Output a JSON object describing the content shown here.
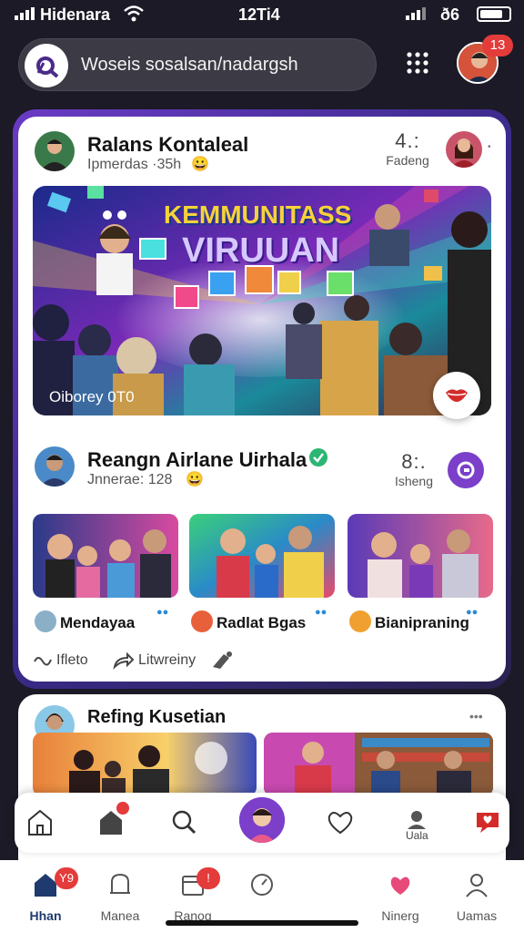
{
  "status_bar": {
    "carrier": "Hidenara",
    "time": "12Ti4",
    "battery": "ð6"
  },
  "search": {
    "text": "Woseis sosalsan/nadargsh"
  },
  "top_badge": "13",
  "post1": {
    "name": "Ralans Kontaleal",
    "meta": "Ipmerdas ·35h",
    "stat_num": "4.:",
    "stat_label": "Fadeng",
    "hero_title_line1": "KEMMUNITASS",
    "hero_title_line2": "VIRUUAN",
    "hero_caption": "Oiborey 0T0"
  },
  "post2": {
    "name": "Reangn Airlane Uirhala",
    "meta": "Jnnerae: 128",
    "stat_num": "8:.",
    "stat_label": "Isheng",
    "thumbs": [
      {
        "label": "Mendayaa"
      },
      {
        "label": "Radlat Bgas"
      },
      {
        "label": "Bianipraning"
      }
    ],
    "actions": {
      "like": "Ifleto",
      "share": "Litwreiny"
    }
  },
  "post3": {
    "name": "Refing Kusetian",
    "more": "•••"
  },
  "inner_nav": {
    "label": "Uala"
  },
  "tabbar": {
    "tabs": [
      {
        "label": "Hhan",
        "badge": "Y9"
      },
      {
        "label": "Manea",
        "badge": ""
      },
      {
        "label": "Ranog",
        "badge": "!"
      },
      {
        "label": "",
        "badge": ""
      },
      {
        "label": "Ninerg",
        "badge": ""
      },
      {
        "label": "Uamas",
        "badge": ""
      }
    ]
  },
  "colors": {
    "accent": "#7b3fc9",
    "badge": "#e43b3b",
    "verified": "#2bb673"
  }
}
